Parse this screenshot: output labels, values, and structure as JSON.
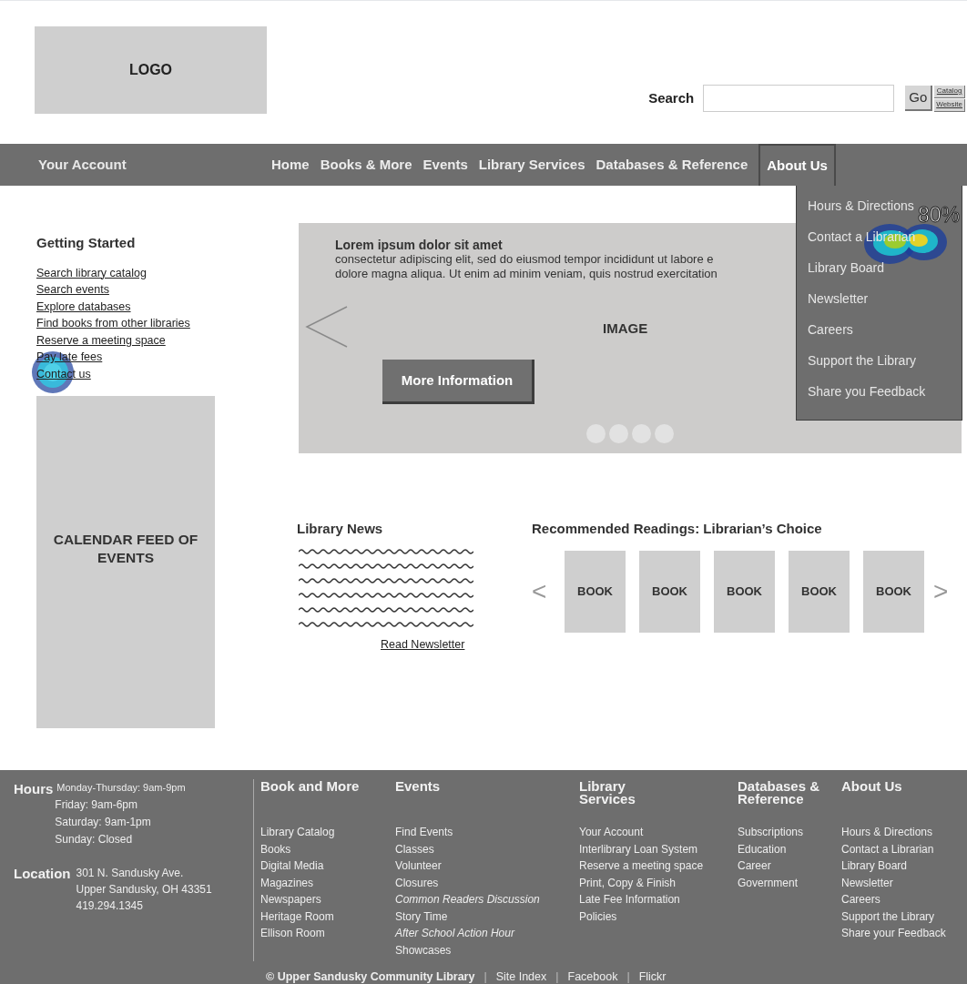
{
  "header": {
    "logo": "LOGO",
    "search": {
      "label": "Search",
      "button": "Go",
      "mini_buttons": [
        "Catalog",
        "Website"
      ]
    }
  },
  "nav": {
    "account": "Your Account",
    "items": [
      {
        "label": "Home",
        "selected": false
      },
      {
        "label": "Books & More",
        "selected": false
      },
      {
        "label": "Events",
        "selected": false
      },
      {
        "label": "Library Services",
        "selected": false
      },
      {
        "label": "Databases & Reference",
        "selected": false
      },
      {
        "label": "About Us",
        "selected": true
      }
    ]
  },
  "dropdown": {
    "items": [
      "Hours & Directions",
      "Contact a Librarian",
      "Library Board",
      "Newsletter",
      "Careers",
      "Support the Library",
      "Share you Feedback"
    ],
    "heatmap_label": "80%"
  },
  "getting_started": {
    "title": "Getting Started",
    "links": [
      "Search library catalog",
      "Search events",
      "Explore databases",
      "Find books from other libraries",
      "Reserve a meeting space",
      "Pay late fees",
      "Contact us"
    ]
  },
  "calendar": "CALENDAR FEED OF EVENTS",
  "hero": {
    "title": "Lorem ipsum dolor sit amet",
    "lines": [
      "consectetur adipiscing elit, sed do eiusmod tempor incididunt ut labore e",
      "dolore magna aliqua. Ut enim ad minim veniam, quis nostrud exercitation"
    ],
    "image_label": "IMAGE",
    "button": "More Information"
  },
  "news": {
    "title": "Library News",
    "link": "Read Newsletter"
  },
  "readings": {
    "title": "Recommended Readings: Librarian’s Choice",
    "prev": "<",
    "next": ">",
    "books": [
      "BOOK",
      "BOOK",
      "BOOK",
      "BOOK",
      "BOOK"
    ]
  },
  "footer": {
    "hours": {
      "label": "Hours",
      "lines": [
        "Monday-Thursday: 9am-9pm",
        "Friday: 9am-6pm",
        "Saturday: 9am-1pm",
        "Sunday: Closed"
      ]
    },
    "location": {
      "label": "Location",
      "lines": [
        "301 N. Sandusky Ave.",
        "Upper Sandusky, OH 43351",
        "419.294.1345"
      ]
    },
    "columns": [
      {
        "title": "Book and More",
        "items": [
          {
            "label": "Library Catalog",
            "italic": false
          },
          {
            "label": "Books",
            "italic": false
          },
          {
            "label": "Digital Media",
            "italic": false
          },
          {
            "label": "Magazines",
            "italic": false
          },
          {
            "label": "Newspapers",
            "italic": false
          },
          {
            "label": "Heritage Room",
            "italic": false
          },
          {
            "label": "Ellison Room",
            "italic": false
          }
        ]
      },
      {
        "title": "Events",
        "items": [
          {
            "label": "Find Events",
            "italic": false
          },
          {
            "label": "Classes",
            "italic": false
          },
          {
            "label": "Volunteer",
            "italic": false
          },
          {
            "label": "Closures",
            "italic": false
          },
          {
            "label": "Common Readers Discussion",
            "italic": true
          },
          {
            "label": "Story Time",
            "italic": false
          },
          {
            "label": "After School Action Hour",
            "italic": true
          },
          {
            "label": "Showcases",
            "italic": false
          }
        ]
      },
      {
        "title": "Library Services",
        "items": [
          {
            "label": "Your Account",
            "italic": false
          },
          {
            "label": "Interlibrary Loan System",
            "italic": false
          },
          {
            "label": "Reserve a meeting space",
            "italic": false
          },
          {
            "label": "Print, Copy & Finish",
            "italic": false
          },
          {
            "label": "Late Fee Information",
            "italic": false
          },
          {
            "label": "Policies",
            "italic": false
          }
        ]
      },
      {
        "title": "Databases & Reference",
        "items": [
          {
            "label": "Subscriptions",
            "italic": false
          },
          {
            "label": "Education",
            "italic": false
          },
          {
            "label": "Career",
            "italic": false
          },
          {
            "label": "Government",
            "italic": false
          }
        ]
      },
      {
        "title": "About Us",
        "items": [
          {
            "label": "Hours & Directions",
            "italic": false
          },
          {
            "label": "Contact a Librarian",
            "italic": false
          },
          {
            "label": "Library Board",
            "italic": false
          },
          {
            "label": "Newsletter",
            "italic": false
          },
          {
            "label": "Careers",
            "italic": false
          },
          {
            "label": "Support the Library",
            "italic": false
          },
          {
            "label": "Share your Feedback",
            "italic": false
          }
        ]
      }
    ],
    "bottom": [
      {
        "label": "© Upper Sandusky Community Library",
        "kind": "copyright"
      },
      {
        "label": "|",
        "kind": "separator"
      },
      {
        "label": "Site Index",
        "kind": "link"
      },
      {
        "label": "|",
        "kind": "separator"
      },
      {
        "label": "Facebook",
        "kind": "link"
      },
      {
        "label": "|",
        "kind": "separator"
      },
      {
        "label": "Flickr",
        "kind": "link"
      }
    ]
  }
}
